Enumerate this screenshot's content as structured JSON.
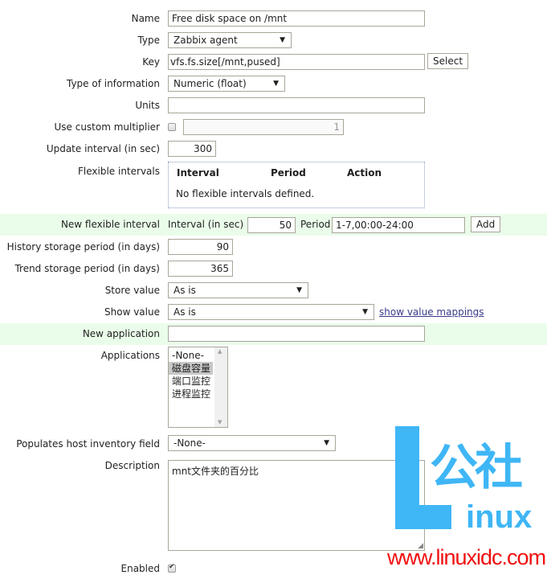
{
  "form": {
    "name": {
      "label": "Name",
      "value": "Free disk space on /mnt"
    },
    "type": {
      "label": "Type",
      "value": "Zabbix agent"
    },
    "key": {
      "label": "Key",
      "value": "vfs.fs.size[/mnt,pused]",
      "select_button": "Select"
    },
    "type_of_information": {
      "label": "Type of information",
      "value": "Numeric (float)"
    },
    "units": {
      "label": "Units",
      "value": ""
    },
    "custom_multiplier": {
      "label": "Use custom multiplier",
      "checked": false,
      "value": "1"
    },
    "update_interval": {
      "label": "Update interval (in sec)",
      "value": "300"
    },
    "flexible_intervals": {
      "label": "Flexible intervals",
      "columns": [
        "Interval",
        "Period",
        "Action"
      ],
      "empty_text": "No flexible intervals defined."
    },
    "new_flexible_interval": {
      "label": "New flexible interval",
      "interval_label": "Interval (in sec)",
      "interval_value": "50",
      "period_label": "Period",
      "period_value": "1-7,00:00-24:00",
      "add_button": "Add"
    },
    "history": {
      "label": "History storage period (in days)",
      "value": "90"
    },
    "trend": {
      "label": "Trend storage period (in days)",
      "value": "365"
    },
    "store_value": {
      "label": "Store value",
      "value": "As is"
    },
    "show_value": {
      "label": "Show value",
      "value": "As is",
      "link": "show value mappings"
    },
    "new_application": {
      "label": "New application",
      "value": ""
    },
    "applications": {
      "label": "Applications",
      "items": [
        "-None-",
        "磁盘容量",
        "端口监控",
        "进程监控"
      ],
      "selected": "磁盘容量"
    },
    "inventory_field": {
      "label": "Populates host inventory field",
      "value": "-None-"
    },
    "description": {
      "label": "Description",
      "value": "mnt文件夹的百分比"
    },
    "enabled": {
      "label": "Enabled",
      "checked": true
    }
  },
  "watermark": {
    "logo_letter": "L",
    "logo_chinese": "公社",
    "logo_text": "inux",
    "url": "www.linuxidc.com",
    "colors": {
      "logo": "#3fb6f6",
      "url": "#f01010"
    }
  },
  "colors": {
    "highlight_row": "#eafdea",
    "border": "#a9a59a",
    "link": "#3a3a8c"
  }
}
